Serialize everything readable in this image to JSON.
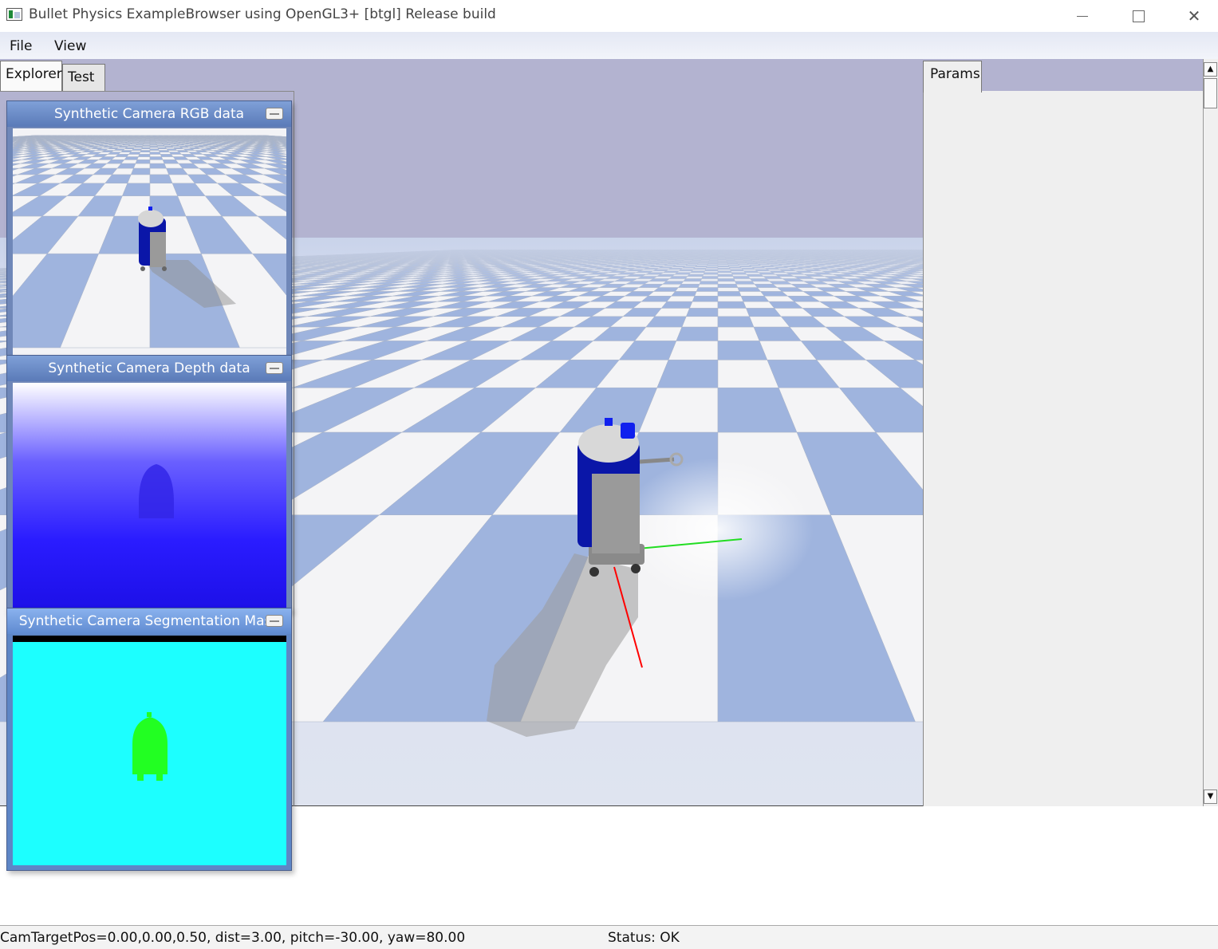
{
  "window": {
    "title": "Bullet Physics ExampleBrowser using OpenGL3+ [btgl] Release build",
    "controls": {
      "minimize": "minimize-icon",
      "maximize": "maximize-icon",
      "close": "close-icon"
    }
  },
  "menu": {
    "items": [
      {
        "label": "File"
      },
      {
        "label": "View"
      }
    ]
  },
  "left_tabs": [
    {
      "label": "Explorer"
    },
    {
      "label": "Test"
    }
  ],
  "right_tabs": [
    {
      "label": "Params"
    }
  ],
  "camera_windows": [
    {
      "title": "Synthetic Camera RGB data"
    },
    {
      "title": "Synthetic Camera Depth data"
    },
    {
      "title": "Synthetic Camera Segmentation Mask"
    }
  ],
  "status": {
    "camera": "CamTargetPos=0.00,0.00,0.50, dist=3.00, pitch=-30.00, yaw=80.00",
    "state": "Status: OK"
  },
  "colors": {
    "sky": "#b3b3d0",
    "tile_blue": "#9fb4de",
    "tile_white": "#f4f4f6",
    "robot_blue": "#0a16a8",
    "robot_gray": "#9a9a9a",
    "segmentation_background": "#1cffff",
    "segmentation_robot": "#22ff22",
    "axis_x": "#ff0000",
    "axis_y": "#22dd22"
  }
}
